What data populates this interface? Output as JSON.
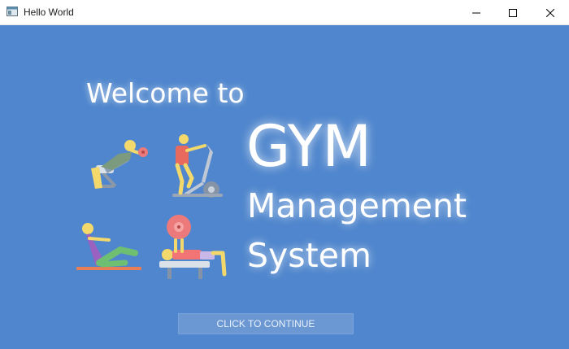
{
  "window": {
    "title": "Hello World",
    "icons": {
      "app": "app-window-icon",
      "minimize": "minimize-icon",
      "maximize": "maximize-icon",
      "close": "close-icon"
    }
  },
  "main": {
    "welcome_text": "Welcome to",
    "title_line1": "GYM",
    "title_line2": "Management",
    "title_line3": "System",
    "continue_label": "CLICK TO CONTINUE",
    "illustrations": [
      "incline-bench-press-icon",
      "elliptical-trainer-icon",
      "sit-up-mat-icon",
      "bench-press-icon"
    ]
  },
  "colors": {
    "background": "#4f86cd",
    "titlebar": "#ffffff",
    "button": "#6b98d3",
    "text": "#ffffff"
  }
}
